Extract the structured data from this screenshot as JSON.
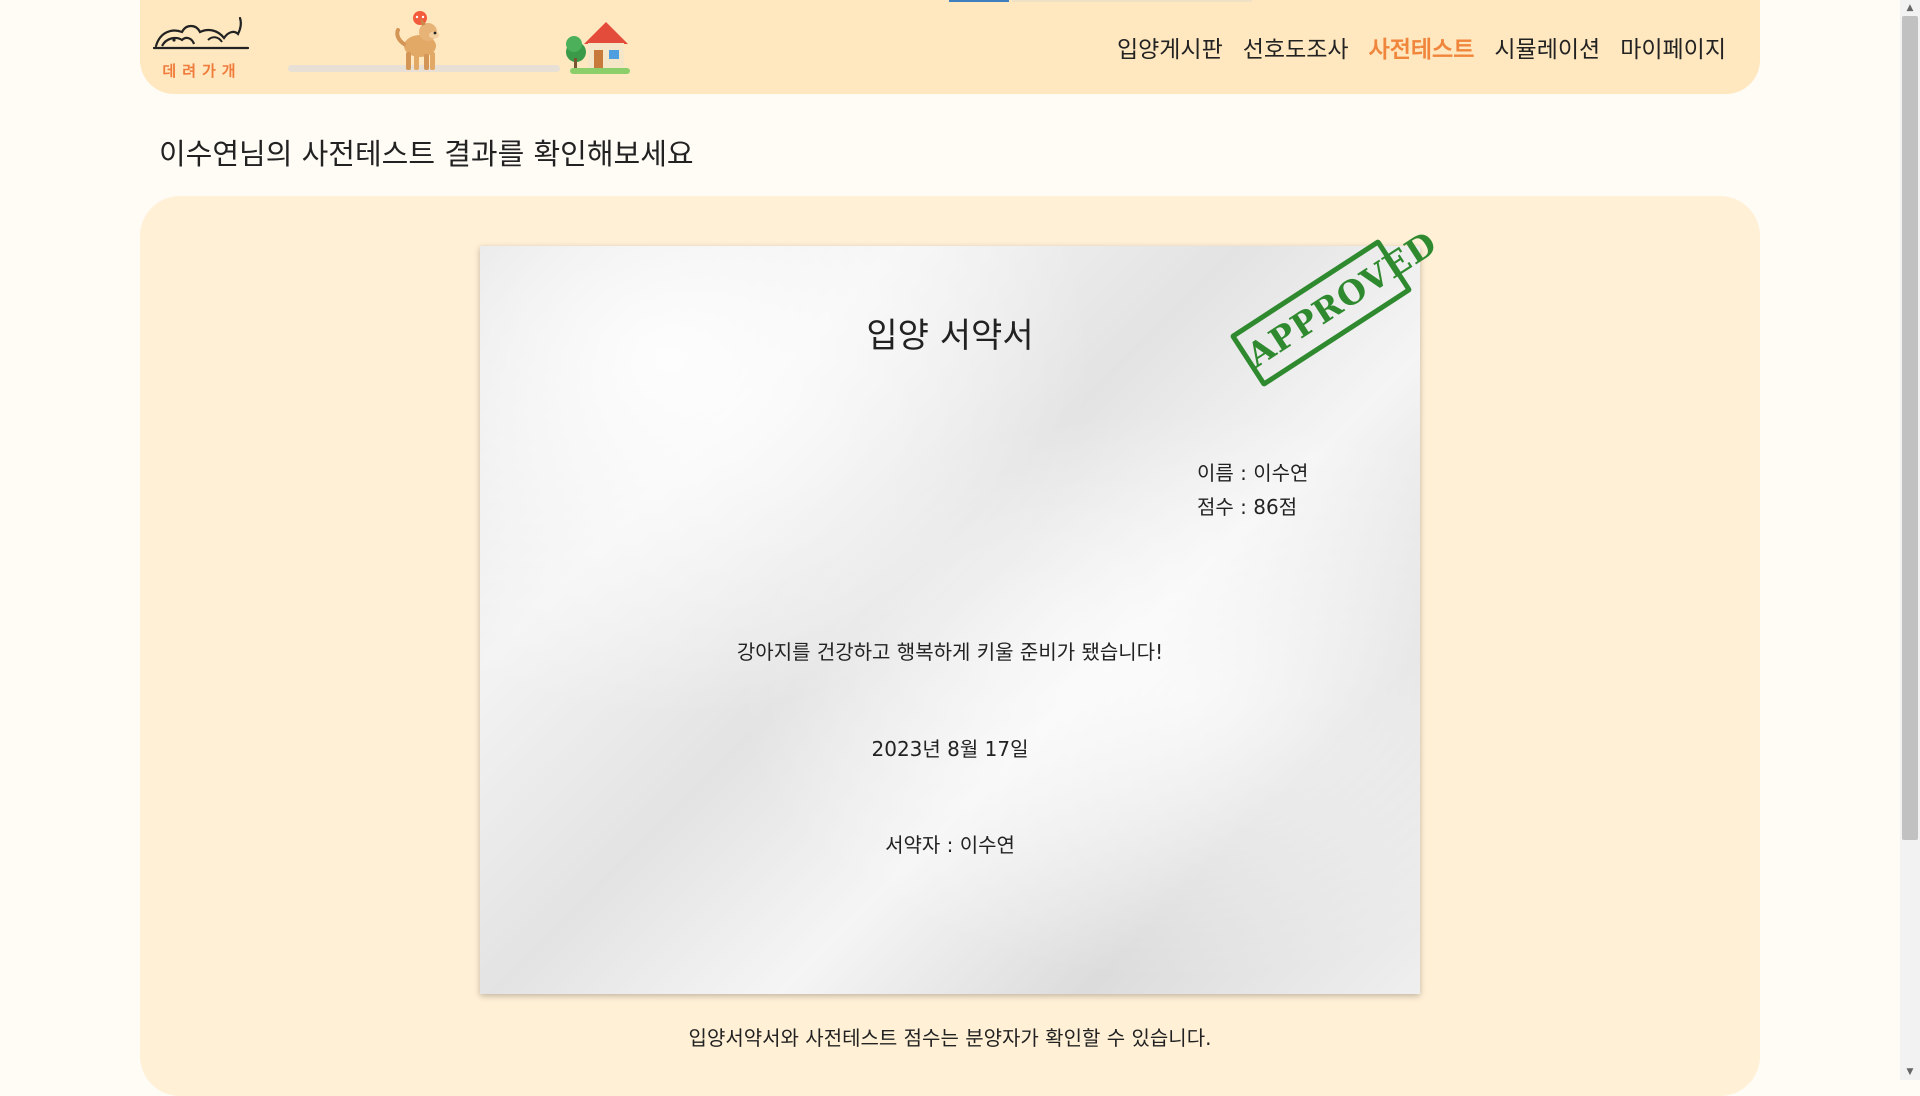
{
  "header": {
    "logo_text": "데려가개",
    "nav": [
      {
        "label": "입양게시판"
      },
      {
        "label": "선호도조사"
      },
      {
        "label": "사전테스트",
        "active": true
      },
      {
        "label": "시뮬레이션"
      },
      {
        "label": "마이페이지"
      }
    ],
    "accent_color": "#f0853c"
  },
  "page": {
    "title": "이수연님의 사전테스트 결과를 확인해보세요"
  },
  "certificate": {
    "title": "입양 서약서",
    "stamp": "APPROVED",
    "name_line": "이름 : 이수연",
    "score_line": "점수 : 86점",
    "message": "강아지를 건강하고 행복하게 키울 준비가 됐습니다!",
    "date": "2023년 8월 17일",
    "signer": "서약자 : 이수연"
  },
  "footnote": "입양서약서와 사전테스트 점수는 분양자가 확인할 수 있습니다.",
  "icons": {
    "logo": "sleeping-dog-icon",
    "progress_dog": "walking-dog-icon",
    "home": "house-icon"
  }
}
